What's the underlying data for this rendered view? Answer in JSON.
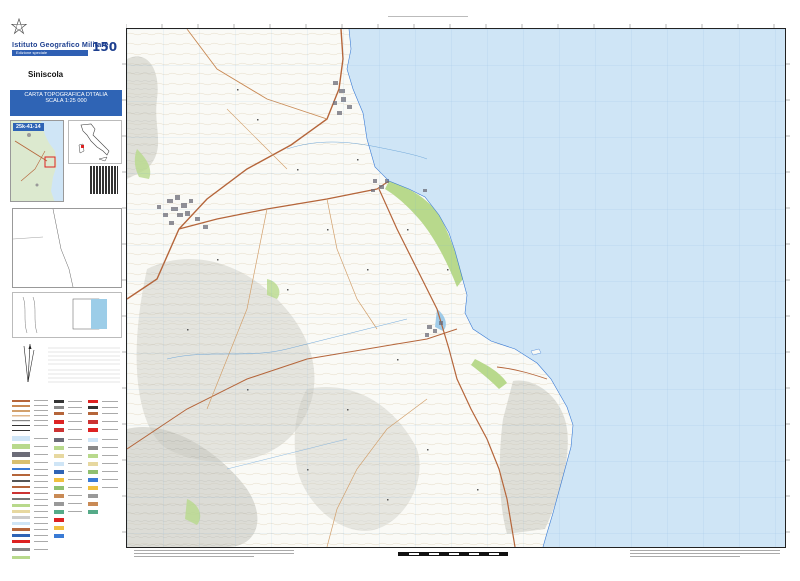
{
  "header": {
    "organization": "Istituto Geografico Militare",
    "edition_label": "Edizione speciale",
    "anniversary_logo": "150",
    "emblem_icon": "italian-republic-emblem-icon"
  },
  "sheet": {
    "name": "Siniscola",
    "series_line1": "CARTA TOPOGRAFICA D'ITALIA",
    "series_line2": "SCALA 1:25 000",
    "code": "25k-41-14"
  },
  "colors": {
    "sea": "#cfe5f6",
    "land": "#fafaf6",
    "relief_shade": "#b9b9b0",
    "vegetation": "#b8d98c",
    "main_road": "#b5653a",
    "secondary_road": "#d2a06c",
    "urban": "#6c6c78",
    "brand_blue": "#2f64b5"
  },
  "map": {
    "feature_icons": [
      "qr-code-icon",
      "locator-map-icon",
      "north-arrow-icon",
      "scale-bar-icon"
    ]
  }
}
